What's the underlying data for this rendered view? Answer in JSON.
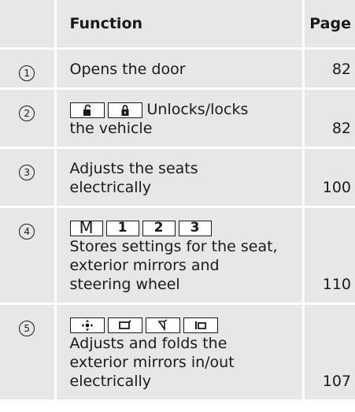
{
  "header": {
    "function_label": "Function",
    "page_label": "Page"
  },
  "rows": [
    {
      "number": "1",
      "lines": [
        "Opens the door"
      ],
      "page": "82"
    },
    {
      "number": "2",
      "keys": [
        "unlock-key-icon",
        "lock-key-icon"
      ],
      "inline_text": "Unlocks/locks",
      "lines": [
        "the vehicle"
      ],
      "page": "82"
    },
    {
      "number": "3",
      "lines": [
        "Adjusts the seats",
        "electrically"
      ],
      "page": "100"
    },
    {
      "number": "4",
      "keys": [
        "M",
        "1",
        "2",
        "3"
      ],
      "lines": [
        "Stores settings for the seat,",
        "exterior mirrors and",
        "steering wheel"
      ],
      "page": "110"
    },
    {
      "number": "5",
      "keys": [
        "mirror-adjust-icon",
        "mirror-left-icon",
        "mirror-right-icon",
        "mirror-fold-icon"
      ],
      "lines": [
        "Adjusts and folds the",
        "exterior mirrors in/out",
        "electrically"
      ],
      "page": "107"
    }
  ]
}
